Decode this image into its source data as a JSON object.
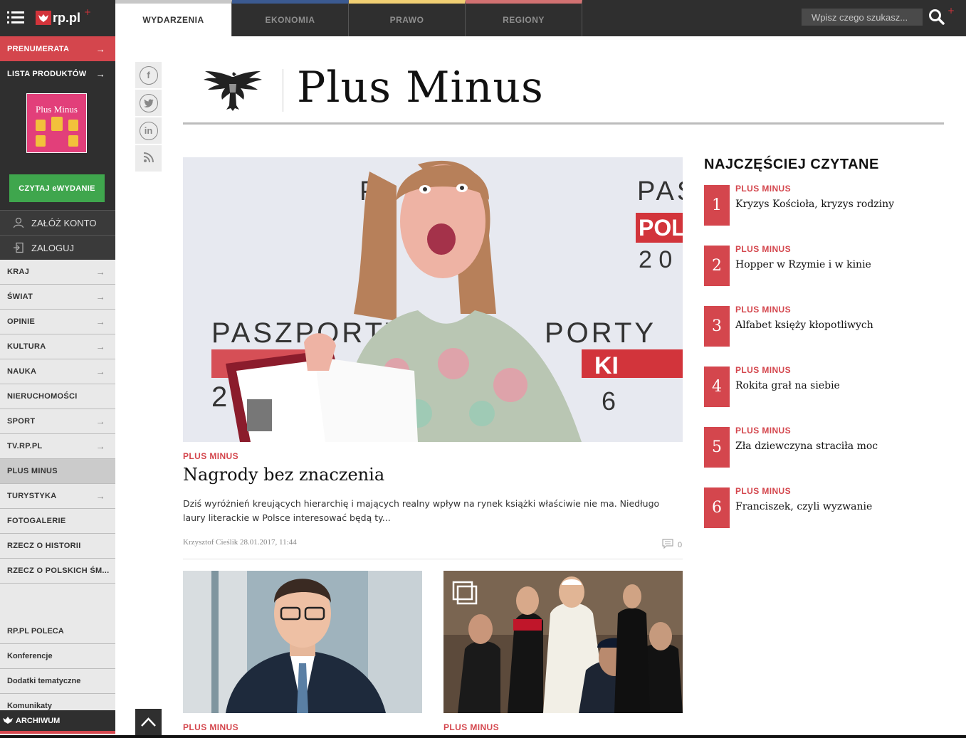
{
  "header": {
    "logo_text": "rp.pl",
    "logo_plus": "+",
    "tabs": [
      {
        "label": "WYDARZENIA",
        "color": "#c7c7c7",
        "active": true
      },
      {
        "label": "EKONOMIA",
        "color": "#3b5a91",
        "active": false
      },
      {
        "label": "PRAWO",
        "color": "#f1cf73",
        "active": false
      },
      {
        "label": "REGIONY",
        "color": "#d27272",
        "active": false
      }
    ],
    "search_placeholder": "Wpisz czego szukasz...",
    "search_plus": "+"
  },
  "sidebar": {
    "prenumerata": "PRENUMERATA",
    "lista_produktow": "LISTA PRODUKTÓW",
    "cover_title": "Plus Minus",
    "ewydanie_button": "CZYTAJ eWYDANIE",
    "zaloz_konto": "ZAŁÓŻ KONTO",
    "zaloguj": "ZALOGUJ",
    "nav": [
      {
        "label": "KRAJ",
        "arrow": true
      },
      {
        "label": "ŚWIAT",
        "arrow": true
      },
      {
        "label": "OPINIE",
        "arrow": true
      },
      {
        "label": "KULTURA",
        "arrow": true
      },
      {
        "label": "NAUKA",
        "arrow": true
      },
      {
        "label": "NIERUCHOMOŚCI",
        "arrow": false
      },
      {
        "label": "SPORT",
        "arrow": true
      },
      {
        "label": "TV.RP.PL",
        "arrow": true
      },
      {
        "label": "PLUS MINUS",
        "arrow": false,
        "selected": true
      },
      {
        "label": "TURYSTYKA",
        "arrow": true
      },
      {
        "label": "FOTOGALERIE",
        "arrow": false
      },
      {
        "label": "RZECZ O HISTORII",
        "arrow": false
      },
      {
        "label": "RZECZ O POLSKICH ŚM...",
        "arrow": false
      }
    ],
    "poleca_title": "RP.PL POLECA",
    "poleca_links": [
      "Konferencje",
      "Dodatki tematyczne",
      "Komunikaty"
    ],
    "archiwum": "ARCHIWUM"
  },
  "share": {
    "icons": [
      "facebook-icon",
      "twitter-icon",
      "linkedin-icon",
      "rss-icon"
    ],
    "glyphs": [
      "f",
      "t",
      "in",
      ")"
    ]
  },
  "page": {
    "title": "Plus Minus"
  },
  "hero": {
    "category": "PLUS MINUS",
    "title": "Nagrody bez znaczenia",
    "lead": "Dziś wyróżnień kreujących hierarchię i mających realny wpływ na rynek książki właściwie nie ma. Niedługo laury literackie w Polsce interesować będą ty...",
    "meta": "Krzysztof Cieślik 28.01.2017, 11:44",
    "comments": "0",
    "image_text_top": "PASZPORTY",
    "image_text_pol": "POL",
    "image_text_ki": "KI"
  },
  "cards": [
    {
      "category": "PLUS MINUS"
    },
    {
      "category": "PLUS MINUS"
    }
  ],
  "most_read": {
    "title": "NAJCZĘŚCIEJ CZYTANE",
    "items": [
      {
        "num": "1",
        "category": "PLUS MINUS",
        "title": "Kryzys Kościoła, kryzys rodziny"
      },
      {
        "num": "2",
        "category": "PLUS MINUS",
        "title": "Hopper w Rzymie i w kinie"
      },
      {
        "num": "3",
        "category": "PLUS MINUS",
        "title": "Alfabet księży kłopotliwych"
      },
      {
        "num": "4",
        "category": "PLUS MINUS",
        "title": "Rokita grał na siebie"
      },
      {
        "num": "5",
        "category": "PLUS MINUS",
        "title": "Zła dziewczyna straciła moc"
      },
      {
        "num": "6",
        "category": "PLUS MINUS",
        "title": "Franciszek, czyli wyzwanie"
      }
    ]
  },
  "colors": {
    "accent": "#d4464d",
    "green_button": "#3fa64d",
    "dark": "#2f2f2f"
  }
}
